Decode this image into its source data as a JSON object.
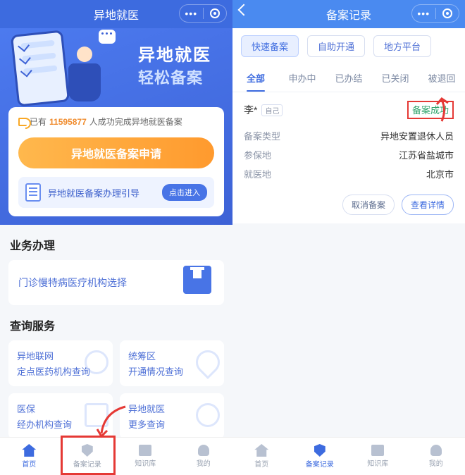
{
  "left": {
    "title": "异地就医",
    "banner": {
      "line1": "异地就医",
      "line2": "轻松备案"
    },
    "counter": {
      "prefix": "已有",
      "count": "11595877",
      "suffix": "人成功完成异地就医备案"
    },
    "apply_btn": "异地就医备案申请",
    "guide": {
      "text": "异地就医备案办理引导",
      "btn": "点击进入"
    },
    "section_biz": "业务办理",
    "biz_card": "门诊慢特病医疗机构选择",
    "section_query": "查询服务",
    "q": [
      {
        "l1": "异地联网",
        "l2": "定点医药机构查询"
      },
      {
        "l1": "统筹区",
        "l2": "开通情况查询"
      },
      {
        "l1": "医保",
        "l2": "经办机构查询"
      },
      {
        "l1": "异地就医",
        "l2": "更多查询"
      }
    ],
    "tabs": [
      "首页",
      "备案记录",
      "知识库",
      "我的"
    ]
  },
  "right": {
    "title": "备案记录",
    "pills": [
      "快速备案",
      "自助开通",
      "地方平台"
    ],
    "tabs": [
      "全部",
      "申办中",
      "已办结",
      "已关闭",
      "被退回"
    ],
    "record": {
      "name": "李*",
      "self_tag": "自己",
      "status": "备案成功",
      "rows": [
        {
          "k": "备案类型",
          "v": "异地安置退休人员"
        },
        {
          "k": "参保地",
          "v": "江苏省盐城市"
        },
        {
          "k": "就医地",
          "v": "北京市"
        }
      ],
      "actions": {
        "cancel": "取消备案",
        "detail": "查看详情"
      }
    },
    "tabs_bottom": [
      "首页",
      "备案记录",
      "知识库",
      "我的"
    ]
  }
}
